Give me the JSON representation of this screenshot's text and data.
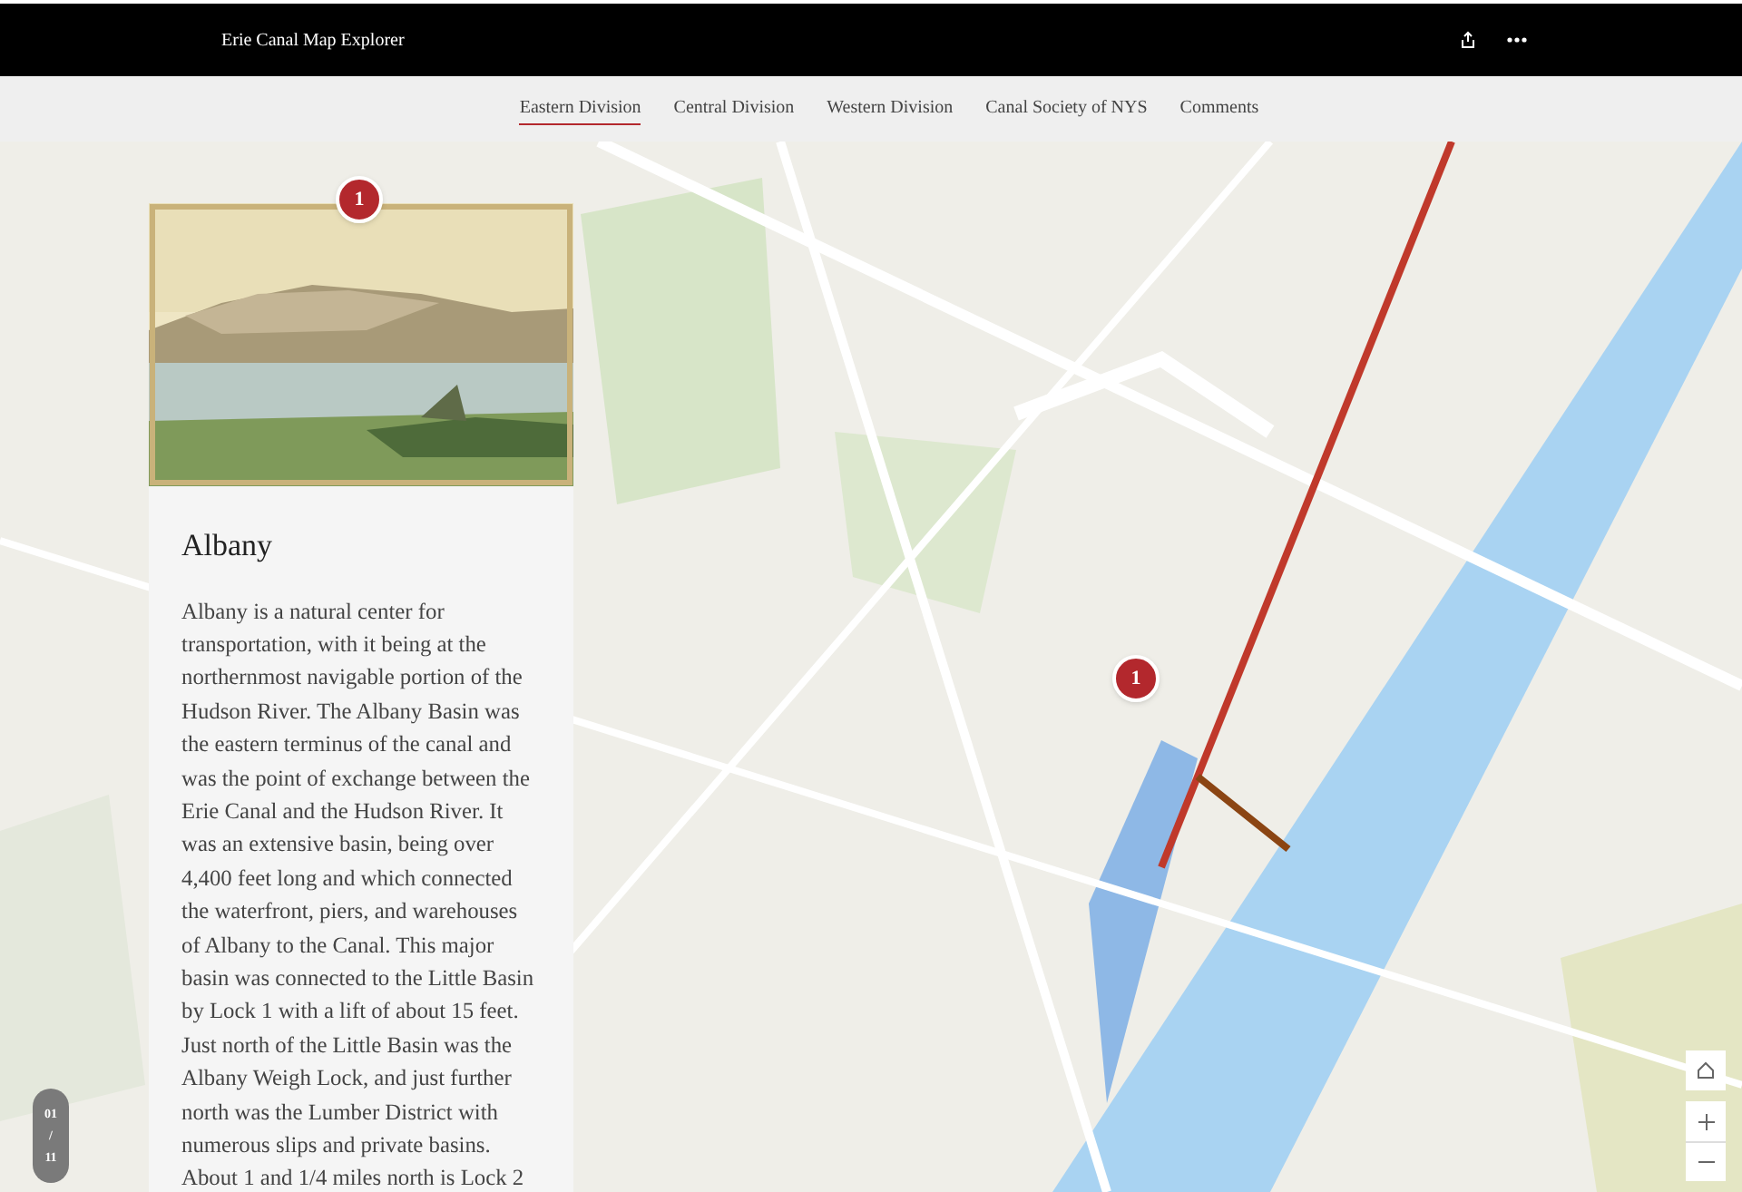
{
  "header": {
    "title": "Erie Canal Map Explorer"
  },
  "tabs": [
    {
      "label": "Eastern Division",
      "selected": true
    },
    {
      "label": "Central Division",
      "selected": false
    },
    {
      "label": "Western Division",
      "selected": false
    },
    {
      "label": "Canal Society of NYS",
      "selected": false
    },
    {
      "label": "Comments",
      "selected": false
    }
  ],
  "map": {
    "kind": "picture",
    "markers": [
      {
        "label": "1"
      }
    ]
  },
  "card": {
    "marker": "1",
    "title": "Albany",
    "body": "Albany is a natural center for transportation, with it being at the northernmost navigable portion of the Hudson River. The Albany Basin was the eastern terminus of the canal and was the point of exchange between the Erie Canal and the Hudson River.  It was an extensive basin, being over 4,400 feet long and which connected the waterfront, piers, and warehouses of Albany to the Canal. This major basin was connected to the Little Basin by Lock 1 with a lift of about 15 feet. Just north of the Little Basin was the Albany Weigh Lock, and just further north was the Lumber District with numerous slips and private basins. About 1 and 1/4 miles north is Lock 2"
  },
  "pager": {
    "current": "01",
    "separator": "/",
    "total": "11"
  }
}
